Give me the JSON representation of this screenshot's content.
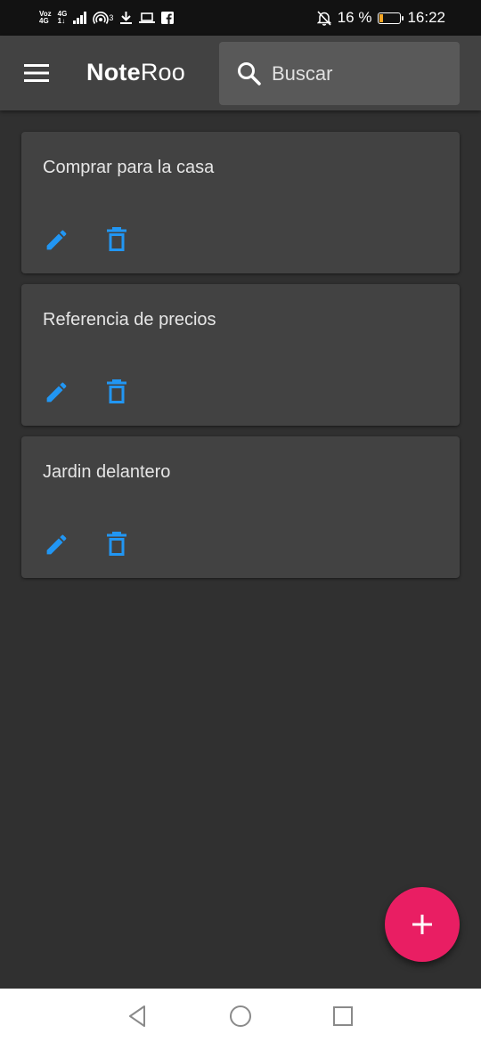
{
  "status_bar": {
    "carrier_top": "Voz",
    "carrier_bottom": "4G",
    "network_top": "4G",
    "network_bottom": "1↓",
    "hotspot_sup": "3",
    "battery_text": "16 %",
    "time": "16:22",
    "battery_level": 0.16,
    "battery_color": "#f5a623"
  },
  "app_bar": {
    "title_bold": "Note",
    "title_rest": "Roo",
    "search_placeholder": "Buscar"
  },
  "notes": [
    {
      "title": "Comprar para la casa",
      "edit_icon": "pencil-icon",
      "delete_icon": "trash-icon"
    },
    {
      "title": "Referencia de precios",
      "edit_icon": "pencil-icon",
      "delete_icon": "trash-icon"
    },
    {
      "title": "Jardin delantero",
      "edit_icon": "pencil-icon",
      "delete_icon": "trash-icon"
    }
  ],
  "fab": {
    "icon": "plus-icon"
  },
  "nav": {
    "back_icon": "back-triangle-icon",
    "home_icon": "home-circle-icon",
    "recents_icon": "recents-square-icon"
  },
  "colors": {
    "background": "#303030",
    "app_bar": "#424242",
    "card": "#424242",
    "accent_blue": "#2196f3",
    "fab": "#e91e63"
  }
}
